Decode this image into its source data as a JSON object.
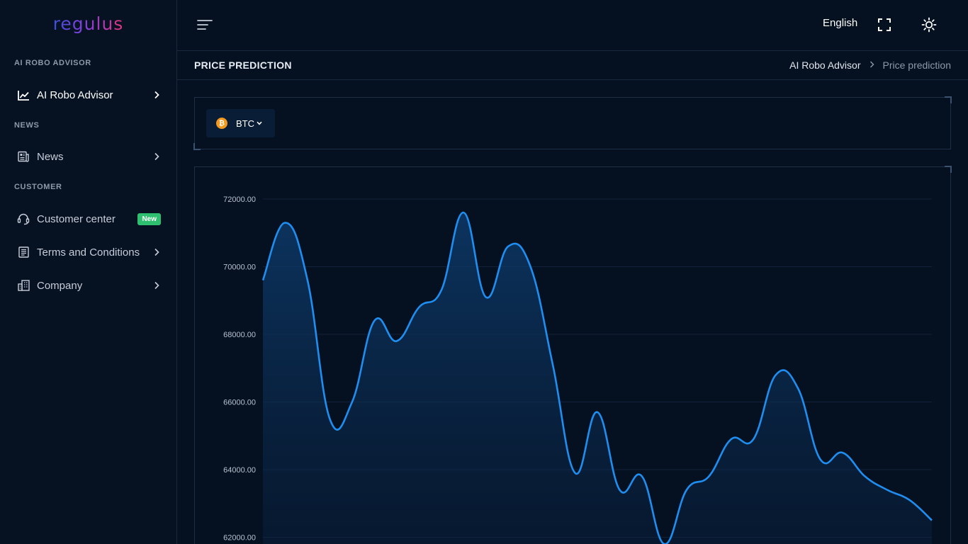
{
  "app": {
    "logo_text": "regulus"
  },
  "sidebar": {
    "sections": [
      {
        "title": "AI ROBO ADVISOR"
      },
      {
        "title": "NEWS"
      },
      {
        "title": "CUSTOMER"
      }
    ],
    "items": [
      {
        "label": "AI Robo Advisor",
        "icon": "chart-line-icon",
        "active": true
      },
      {
        "label": "News",
        "icon": "newspaper-icon"
      },
      {
        "label": "Customer center",
        "icon": "headset-icon",
        "badge": "New"
      },
      {
        "label": "Terms and Conditions",
        "icon": "document-icon"
      },
      {
        "label": "Company",
        "icon": "building-icon"
      }
    ]
  },
  "topbar": {
    "language": "English",
    "menu_icon": "hamburger-icon",
    "fullscreen_icon": "fullscreen-icon",
    "theme_icon": "sun-icon"
  },
  "page": {
    "title": "PRICE PREDICTION",
    "breadcrumb": [
      "AI Robo Advisor",
      "Price prediction"
    ]
  },
  "selector": {
    "coin": "BTC",
    "coin_symbol": "₿",
    "coin_color": "#f39a1e"
  },
  "colors": {
    "line": "#1e8ef0",
    "background": "#051020",
    "accent_green": "#2fbf71"
  },
  "chart_data": {
    "type": "area",
    "ylim": [
      62000,
      72000
    ],
    "yticks": [
      "72000.00",
      "70000.00",
      "68000.00",
      "66000.00",
      "64000.00",
      "62000.00"
    ],
    "ytick_values": [
      72000,
      70000,
      68000,
      66000,
      64000,
      62000
    ],
    "values": [
      69600,
      71300,
      69600,
      65500,
      66000,
      68400,
      67800,
      68800,
      69300,
      71600,
      69100,
      70600,
      70000,
      67100,
      63900,
      65700,
      63400,
      63800,
      61800,
      63400,
      63800,
      64900,
      64900,
      66800,
      66400,
      64300,
      64500,
      63800,
      63400,
      63100,
      62500
    ]
  }
}
